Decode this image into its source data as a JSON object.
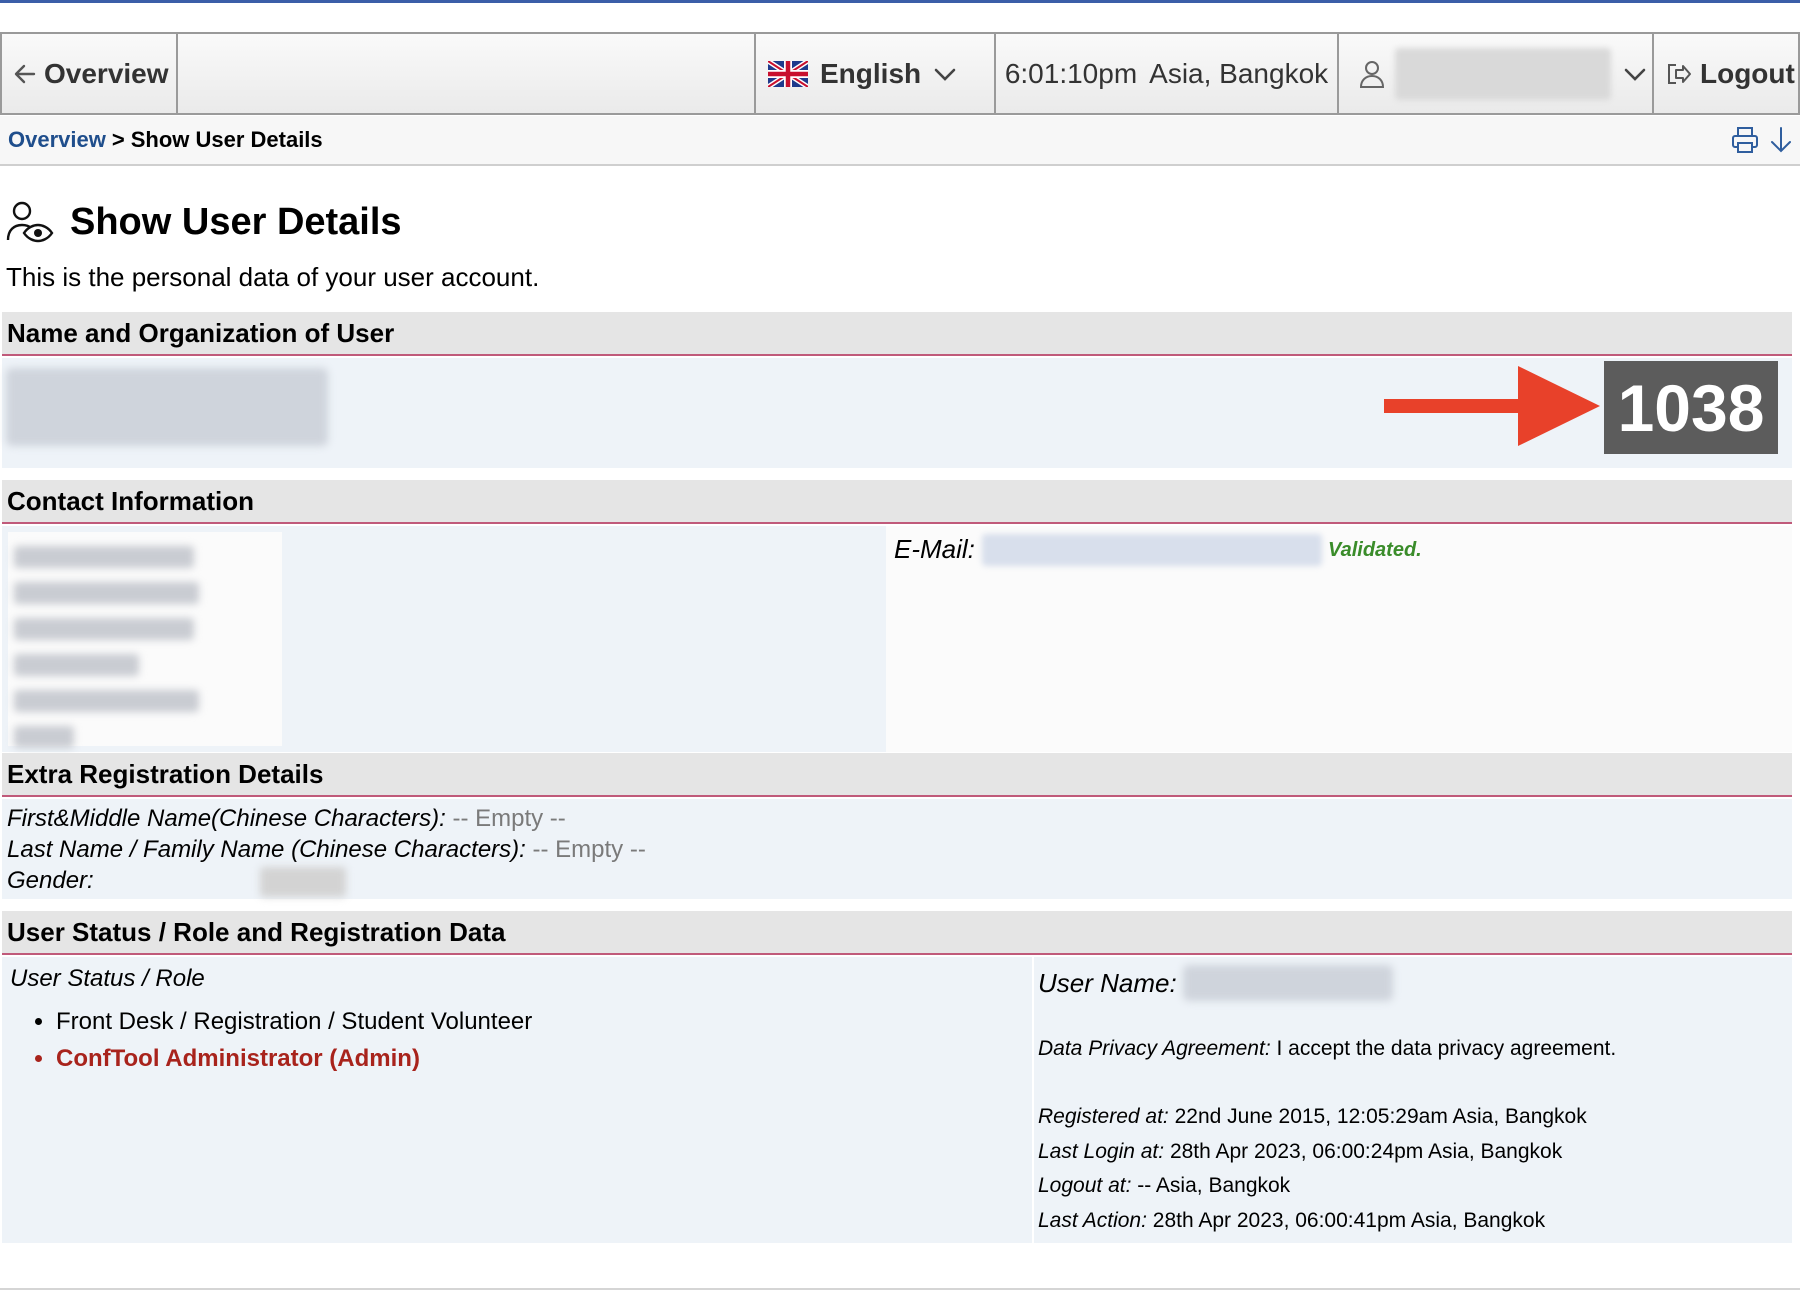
{
  "nav": {
    "overview_label": "Overview",
    "language_label": "English",
    "time": "6:01:10pm",
    "timezone": "Asia, Bangkok",
    "logout_label": "Logout"
  },
  "breadcrumb": {
    "link_label": "Overview",
    "separator": ">",
    "current_label": "Show User Details"
  },
  "page": {
    "title": "Show User Details",
    "subtitle": "This is the personal data of your user account."
  },
  "sections": {
    "name_org": {
      "heading": "Name and Organization of User",
      "user_id": "1038"
    },
    "contact": {
      "heading": "Contact Information",
      "email_label": "E-Mail:",
      "email_status": "Validated."
    },
    "extra": {
      "heading": "Extra Registration Details",
      "rows": [
        {
          "key": "First&Middle Name(Chinese Characters):",
          "value": "-- Empty --"
        },
        {
          "key": "Last Name / Family Name (Chinese Characters):",
          "value": "-- Empty --"
        },
        {
          "key": "Gender:",
          "value": ""
        }
      ]
    },
    "status": {
      "heading": "User Status / Role and Registration Data",
      "role_label": "User Status / Role",
      "roles": [
        "Front Desk / Registration / Student Volunteer",
        "ConfTool Administrator (Admin)"
      ],
      "username_label": "User Name:",
      "privacy_label": "Data Privacy Agreement:",
      "privacy_value": "I accept the data privacy agreement.",
      "registered_label": "Registered at:",
      "registered_value": "22nd June 2015, 12:05:29am Asia, Bangkok",
      "last_login_label": "Last Login at:",
      "last_login_value": "28th Apr 2023, 06:00:24pm Asia, Bangkok",
      "logout_label": "Logout at:",
      "logout_value": "-- Asia, Bangkok",
      "last_action_label": "Last Action:",
      "last_action_value": "28th Apr 2023, 06:00:41pm Asia, Bangkok"
    }
  },
  "colors": {
    "link": "#1f4e8c",
    "admin_role": "#a8231c",
    "validated": "#3a8c2a",
    "annotation_arrow": "#e8412a",
    "id_box": "#5c5c5c",
    "section_rule": "#c05a7a"
  },
  "icons": {
    "back": "arrow-left-icon",
    "flag": "uk-flag-icon",
    "chevron": "chevron-down-icon",
    "user": "user-icon",
    "logout": "logout-icon",
    "print": "printer-icon",
    "download": "arrow-down-icon",
    "title": "user-eye-icon"
  }
}
